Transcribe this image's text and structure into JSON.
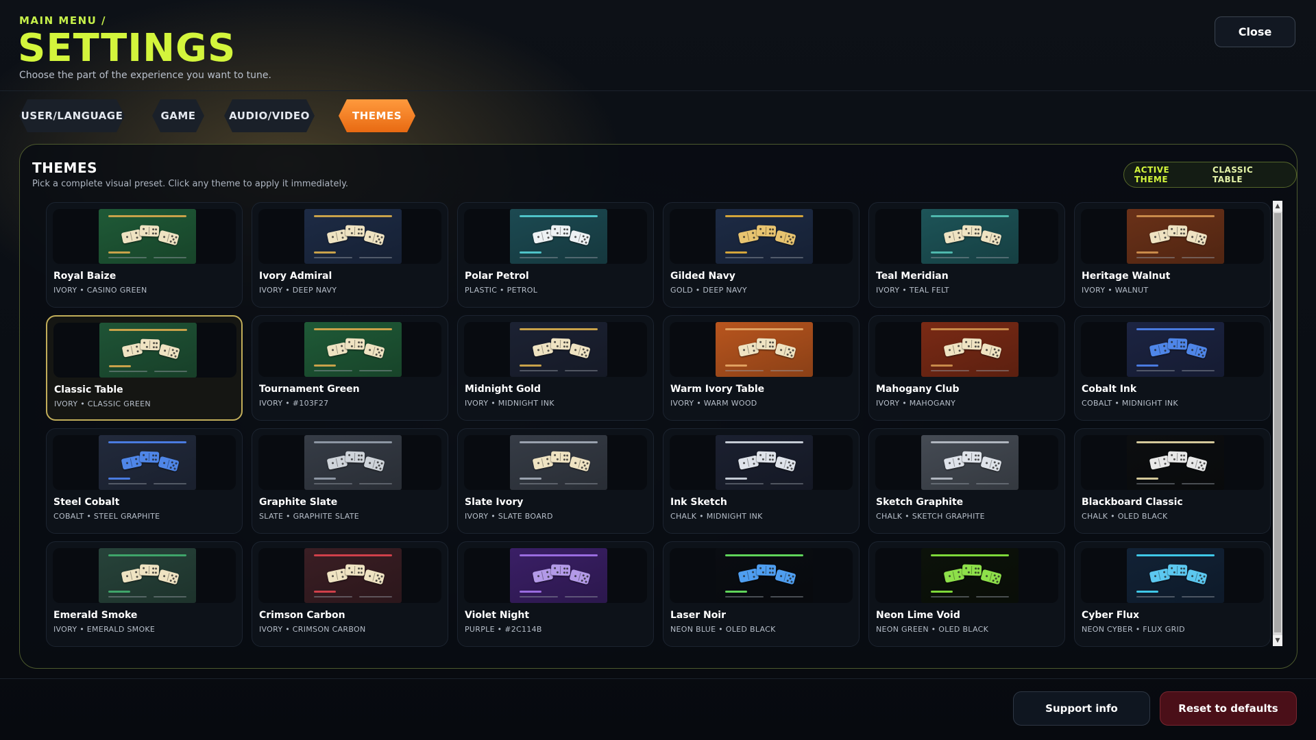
{
  "header": {
    "breadcrumb": "MAIN MENU /",
    "title": "SETTINGS",
    "subtitle": "Choose the part of the experience you want to tune.",
    "close_label": "Close"
  },
  "tabs": [
    {
      "label": "USER/LANGUAGE",
      "active": false
    },
    {
      "label": "GAME",
      "active": false
    },
    {
      "label": "AUDIO/VIDEO",
      "active": false
    },
    {
      "label": "THEMES",
      "active": true
    }
  ],
  "panel": {
    "title": "THEMES",
    "description": "Pick a complete visual preset. Click any theme to apply it immediately.",
    "active_label": "ACTIVE THEME",
    "active_value": "CLASSIC TABLE"
  },
  "themes": [
    {
      "name": "Royal Baize",
      "sub": "IVORY • CASINO GREEN",
      "bg": "#1f5a37",
      "accent": "#c9a24a",
      "tile": "#efe3c2",
      "selected": false
    },
    {
      "name": "Ivory Admiral",
      "sub": "IVORY • DEEP NAVY",
      "bg": "#1d2b45",
      "accent": "#c9a24a",
      "tile": "#efe3c2",
      "selected": false
    },
    {
      "name": "Polar Petrol",
      "sub": "PLASTIC • PETROL",
      "bg": "#1c4a52",
      "accent": "#4fc3c8",
      "tile": "#eef2f4",
      "selected": false
    },
    {
      "name": "Gilded Navy",
      "sub": "GOLD • DEEP NAVY",
      "bg": "#1d2b45",
      "accent": "#d4a53a",
      "tile": "#e8c470",
      "selected": false
    },
    {
      "name": "Teal Meridian",
      "sub": "IVORY • TEAL FELT",
      "bg": "#1d5458",
      "accent": "#4fb8ad",
      "tile": "#efe3c2",
      "selected": false
    },
    {
      "name": "Heritage Walnut",
      "sub": "IVORY • WALNUT",
      "bg": "#6a3118",
      "accent": "#c98a4a",
      "tile": "#efe3c2",
      "selected": false
    },
    {
      "name": "Classic Table",
      "sub": "IVORY • CLASSIC GREEN",
      "bg": "#1f5436",
      "accent": "#c9a24a",
      "tile": "#efe3c2",
      "selected": true
    },
    {
      "name": "Tournament Green",
      "sub": "IVORY • #103F27",
      "bg": "#1f5a37",
      "accent": "#c9a24a",
      "tile": "#efe3c2",
      "selected": false
    },
    {
      "name": "Midnight Gold",
      "sub": "IVORY • MIDNIGHT INK",
      "bg": "#1c2233",
      "accent": "#c9a24a",
      "tile": "#efe3c2",
      "selected": false
    },
    {
      "name": "Warm Ivory Table",
      "sub": "IVORY • WARM WOOD",
      "bg": "#b8551e",
      "accent": "#e0a060",
      "tile": "#efe3c2",
      "selected": false
    },
    {
      "name": "Mahogany Club",
      "sub": "IVORY • MAHOGANY",
      "bg": "#7a2a15",
      "accent": "#c98a4a",
      "tile": "#efe3c2",
      "selected": false
    },
    {
      "name": "Cobalt Ink",
      "sub": "COBALT • MIDNIGHT INK",
      "bg": "#1c2442",
      "accent": "#4a7be0",
      "tile": "#4f86e8",
      "selected": false
    },
    {
      "name": "Steel Cobalt",
      "sub": "COBALT • STEEL GRAPHITE",
      "bg": "#222a3c",
      "accent": "#4a7be0",
      "tile": "#4f86e8",
      "selected": false
    },
    {
      "name": "Graphite Slate",
      "sub": "SLATE • GRAPHITE SLATE",
      "bg": "#363c46",
      "accent": "#8d96a3",
      "tile": "#cfd4da",
      "selected": false
    },
    {
      "name": "Slate Ivory",
      "sub": "IVORY • SLATE BOARD",
      "bg": "#363c46",
      "accent": "#9aa2ae",
      "tile": "#efe3c2",
      "selected": false
    },
    {
      "name": "Ink Sketch",
      "sub": "CHALK • MIDNIGHT INK",
      "bg": "#1b2030",
      "accent": "#c5cbd5",
      "tile": "#dfe3ea",
      "selected": false
    },
    {
      "name": "Sketch Graphite",
      "sub": "CHALK • SKETCH GRAPHITE",
      "bg": "#454b54",
      "accent": "#b0b6bf",
      "tile": "#dfe3ea",
      "selected": false
    },
    {
      "name": "Blackboard Classic",
      "sub": "CHALK • OLED BLACK",
      "bg": "#0c0e10",
      "accent": "#d4c89a",
      "tile": "#e8e8e8",
      "selected": false
    },
    {
      "name": "Emerald Smoke",
      "sub": "IVORY • EMERALD SMOKE",
      "bg": "#27433a",
      "accent": "#3fa56a",
      "tile": "#efe3c2",
      "selected": false
    },
    {
      "name": "Crimson Carbon",
      "sub": "IVORY • CRIMSON CARBON",
      "bg": "#3a1e24",
      "accent": "#d0404a",
      "tile": "#efe3c2",
      "selected": false
    },
    {
      "name": "Violet Night",
      "sub": "PURPLE • #2C114B",
      "bg": "#3a1f66",
      "accent": "#9a6ce0",
      "tile": "#b39ae8",
      "selected": false
    },
    {
      "name": "Laser Noir",
      "sub": "NEON BLUE • OLED BLACK",
      "bg": "#0a0d12",
      "accent": "#5fd45a",
      "tile": "#4f9ef0",
      "selected": false
    },
    {
      "name": "Neon Lime Void",
      "sub": "NEON GREEN • OLED BLACK",
      "bg": "#0c120a",
      "accent": "#7ed83a",
      "tile": "#8ee04a",
      "selected": false
    },
    {
      "name": "Cyber Flux",
      "sub": "NEON CYBER • FLUX GRID",
      "bg": "#122236",
      "accent": "#3fc8e8",
      "tile": "#5cc8f0",
      "selected": false
    }
  ],
  "footer": {
    "support_label": "Support info",
    "reset_label": "Reset to defaults"
  },
  "icons": {
    "scroll_up": "scroll-up-arrow-icon",
    "scroll_down": "scroll-down-arrow-icon"
  }
}
